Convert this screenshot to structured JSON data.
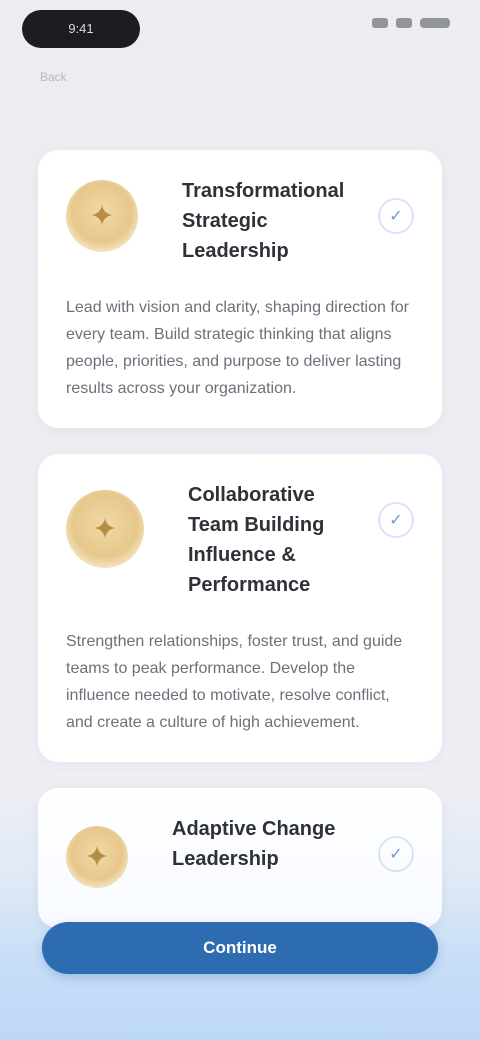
{
  "status_bar": {
    "time": "9:41",
    "icons": [
      "signal-icon",
      "wifi-icon",
      "battery-icon"
    ]
  },
  "nav": {
    "back_label": "Back"
  },
  "items": [
    {
      "title": "Transformational Strategic Leadership",
      "description": "Lead with vision and clarity, shaping direction for every team. Build strategic thinking that aligns people, priorities, and purpose to deliver lasting results across your organization.",
      "icon": "award-icon",
      "selected": true
    },
    {
      "title": "Collaborative Team Building Influence & Performance",
      "description": "Strengthen relationships, foster trust, and guide teams to peak performance. Develop the influence needed to motivate, resolve conflict, and create a culture of high achievement.",
      "icon": "award-icon",
      "selected": true
    },
    {
      "title": "Adaptive Change Leadership",
      "description": "",
      "icon": "award-icon",
      "selected": true
    }
  ],
  "primary_action": {
    "label": "Continue"
  },
  "colors": {
    "accent": "#2e6cb1",
    "card_background": "#ffffff",
    "page_background": "#ececf1"
  }
}
